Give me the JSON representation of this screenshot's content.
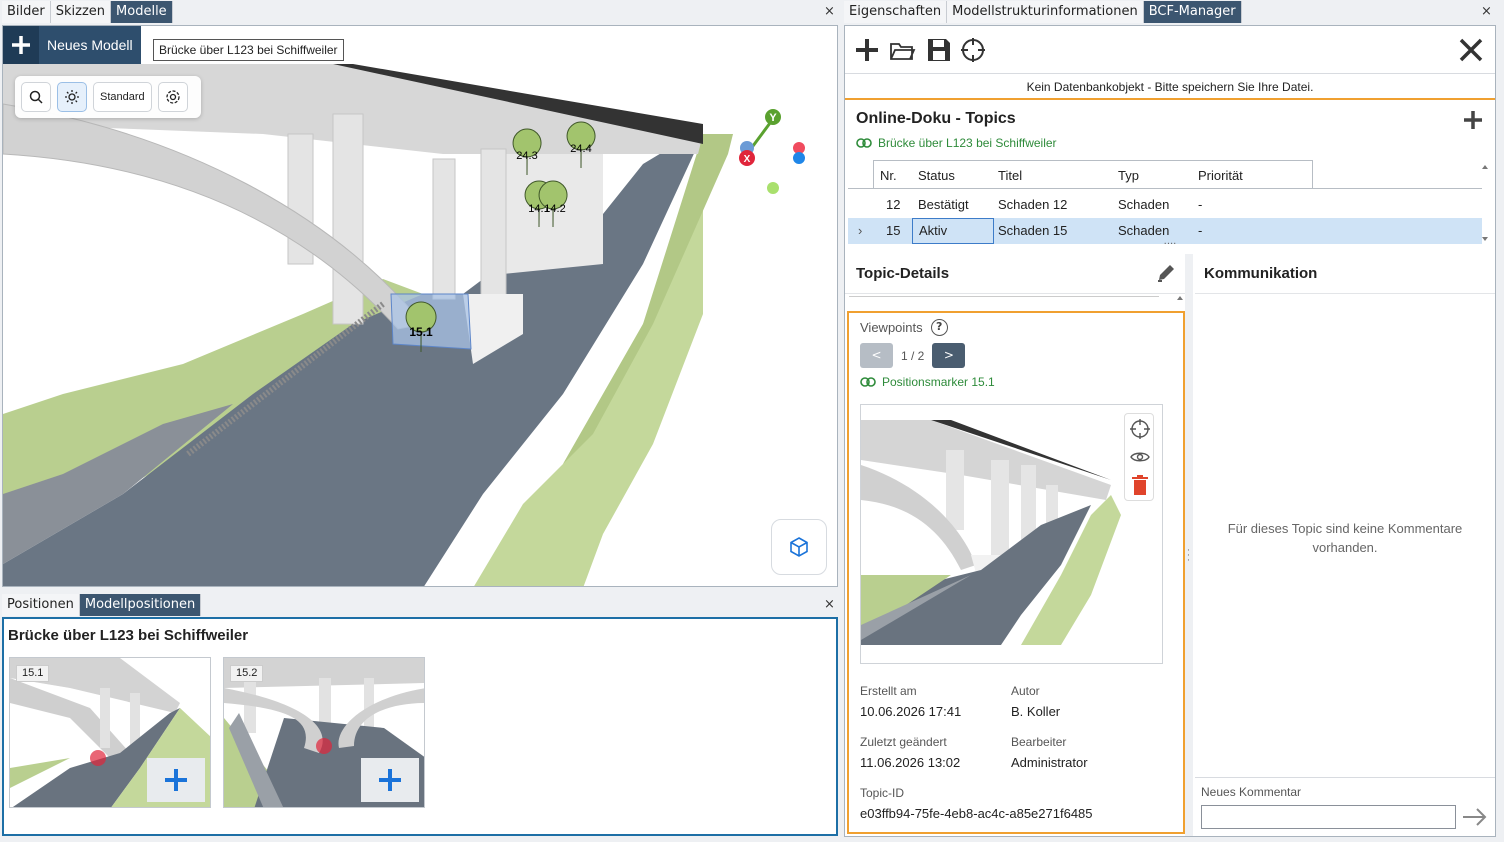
{
  "left_tabs": [
    {
      "label": "Bilder",
      "active": false
    },
    {
      "label": "Skizzen",
      "active": false
    },
    {
      "label": "Modelle",
      "active": true
    }
  ],
  "close_glyph": "×",
  "model_toolbar": {
    "new_model_label": "Neues Modell",
    "model_tab_label": "Brücke über L123 bei Schiffweiler"
  },
  "view_tools": {
    "standard_label": "Standard"
  },
  "markers": [
    {
      "label": "24.3"
    },
    {
      "label": "24.4"
    },
    {
      "label": "14.1"
    },
    {
      "label": "14.2"
    },
    {
      "label": "15.1"
    }
  ],
  "axes": {
    "y": "Y",
    "x": "X"
  },
  "bottom_tabs": [
    {
      "label": "Positionen",
      "active": false
    },
    {
      "label": "Modellpositionen",
      "active": true
    }
  ],
  "positions": {
    "title": "Brücke über L123 bei Schiffweiler",
    "items": [
      {
        "label": "15.1"
      },
      {
        "label": "15.2"
      }
    ]
  },
  "right_tabs": [
    {
      "label": "Eigenschaften",
      "active": false
    },
    {
      "label": "Modellstrukturinformationen",
      "active": false
    },
    {
      "label": "BCF-Manager",
      "active": true
    }
  ],
  "bcf": {
    "db_notice": "Kein Datenbankobjekt - Bitte speichern Sie Ihre Datei.",
    "topics_title": "Online-Doku - Topics",
    "model_link": "Brücke über L123 bei Schiffweiler",
    "columns": [
      "Nr.",
      "Status",
      "Titel",
      "Typ",
      "Priorität"
    ],
    "rows": [
      {
        "nr": "12",
        "status": "Bestätigt",
        "titel": "Schaden 12",
        "typ": "Schaden",
        "prio": "-",
        "selected": false
      },
      {
        "nr": "15",
        "status": "Aktiv",
        "titel": "Schaden 15",
        "typ": "Schaden",
        "prio": "-",
        "selected": true
      }
    ],
    "details_title": "Topic-Details",
    "viewpoints_label": "Viewpoints",
    "help_glyph": "?",
    "pager": {
      "prev": "<",
      "next": ">",
      "text": "1 / 2"
    },
    "viewpoint_link": "Positionsmarker 15.1",
    "meta": {
      "created_label": "Erstellt am",
      "created_value": "10.06.2026 17:41",
      "author_label": "Autor",
      "author_value": "B. Koller",
      "changed_label": "Zuletzt geändert",
      "changed_value": "11.06.2026 13:02",
      "editor_label": "Bearbeiter",
      "editor_value": "Administrator",
      "topic_id_label": "Topic-ID",
      "topic_id_value": "e03ffb94-75fe-4eb8-ac4c-a85e271f6485"
    },
    "comm_title": "Kommunikation",
    "no_comments": "Für dieses Topic sind keine Kommentare vorhanden.",
    "new_comment_label": "Neues Kommentar"
  },
  "colors": {
    "accent_dark": "#3c5670",
    "orange": "#f0a030",
    "green_link": "#2e8b3a",
    "selection": "#cfe3f6",
    "plus_blue": "#1a73d9",
    "delete_red": "#e0442b"
  }
}
